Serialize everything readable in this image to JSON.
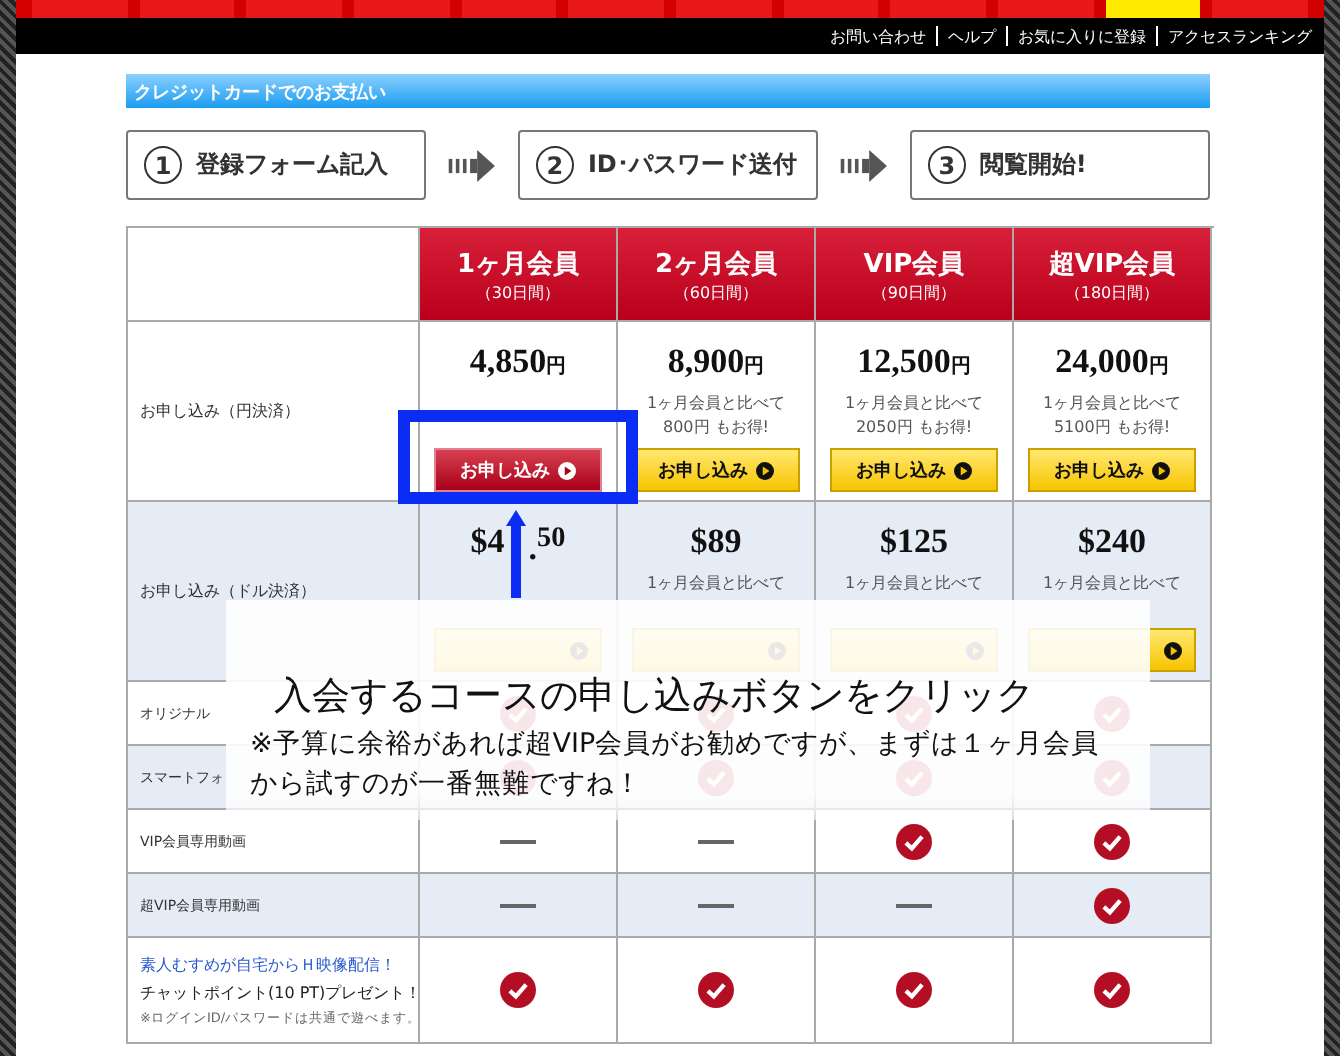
{
  "nav_tabs": [
    {
      "selected": false
    },
    {
      "selected": false
    },
    {
      "selected": false
    },
    {
      "selected": false
    },
    {
      "selected": false
    },
    {
      "selected": false
    },
    {
      "selected": false
    },
    {
      "selected": false
    },
    {
      "selected": false
    },
    {
      "selected": false
    },
    {
      "selected": true
    },
    {
      "selected": false
    }
  ],
  "top_links": [
    "お問い合わせ",
    "ヘルプ",
    "お気に入りに登録",
    "アクセスランキング"
  ],
  "section_title": "クレジットカードでのお支払い",
  "steps": [
    {
      "number": "1",
      "label": "登録フォーム記入"
    },
    {
      "number": "2",
      "label": "ID･パスワード送付"
    },
    {
      "number": "3",
      "label": "閲覧開始!"
    }
  ],
  "plans": [
    {
      "name": "1ヶ月会員",
      "duration": "（30日間）"
    },
    {
      "name": "2ヶ月会員",
      "duration": "（60日間）"
    },
    {
      "name": "VIP会員",
      "duration": "（90日間）"
    },
    {
      "name": "超VIP会員",
      "duration": "（180日間）"
    }
  ],
  "price_rows": [
    {
      "label": "お申し込み（円決済）",
      "kind": "yen",
      "cells": [
        {
          "price": "4,850",
          "unit": "円",
          "button": "お申し込み",
          "selected": true
        },
        {
          "price": "8,900",
          "unit": "円",
          "note": [
            "1ヶ月会員と比べて",
            "800円 もお得!"
          ],
          "button": "お申し込み",
          "selected": false
        },
        {
          "price": "12,500",
          "unit": "円",
          "note": [
            "1ヶ月会員と比べて",
            "2050円 もお得!"
          ],
          "button": "お申し込み",
          "selected": false
        },
        {
          "price": "24,000",
          "unit": "円",
          "note": [
            "1ヶ月会員と比べて",
            "5100円 もお得!"
          ],
          "button": "お申し込み",
          "selected": false
        }
      ]
    },
    {
      "label": "お申し込み（ドル決済）",
      "kind": "dollar",
      "cells": [
        {
          "price": "$4",
          "price_tail": ".$^{50}$",
          "selected": false
        },
        {
          "price": "$89",
          "note": [
            "1ヶ月会員と比べて"
          ],
          "selected": false
        },
        {
          "price": "$125",
          "note": [
            "1ヶ月会員と比べて"
          ],
          "selected": false
        },
        {
          "price": "$240",
          "note": [
            "1ヶ月会員と比べて"
          ],
          "selected": false
        }
      ]
    }
  ],
  "features": [
    {
      "label": "オリジナル",
      "marks": [
        {
          "kind": "check"
        },
        {
          "kind": "check"
        },
        {
          "kind": "check"
        },
        {
          "kind": "check"
        }
      ]
    },
    {
      "label": "スマートフォ",
      "marks": [
        {
          "kind": "check"
        },
        {
          "kind": "check"
        },
        {
          "kind": "check"
        },
        {
          "kind": "check"
        }
      ]
    },
    {
      "label": "VIP会員専用動画",
      "marks": [
        {
          "kind": "dash"
        },
        {
          "kind": "dash"
        },
        {
          "kind": "check"
        },
        {
          "kind": "check"
        }
      ]
    },
    {
      "label": "超VIP会員専用動画",
      "marks": [
        {
          "kind": "dash"
        },
        {
          "kind": "dash"
        },
        {
          "kind": "dash"
        },
        {
          "kind": "check"
        }
      ]
    }
  ],
  "bonus_row": {
    "link": "素人むすめが自宅からＨ映像配信！",
    "text": "チャットポイント(10 PT)プレゼント！",
    "note": "※ログインID/パスワードは共通で遊べます。",
    "marks": [
      {
        "kind": "check"
      },
      {
        "kind": "check"
      },
      {
        "kind": "check"
      },
      {
        "kind": "check"
      }
    ]
  },
  "callout": {
    "title": "入会するコースの申し込みボタンをクリック",
    "note_lines": [
      "※予算に余裕があれば超VIP会員がお勧めですが、まずは１ヶ月会員",
      "から試すのが一番無難ですね！"
    ]
  }
}
